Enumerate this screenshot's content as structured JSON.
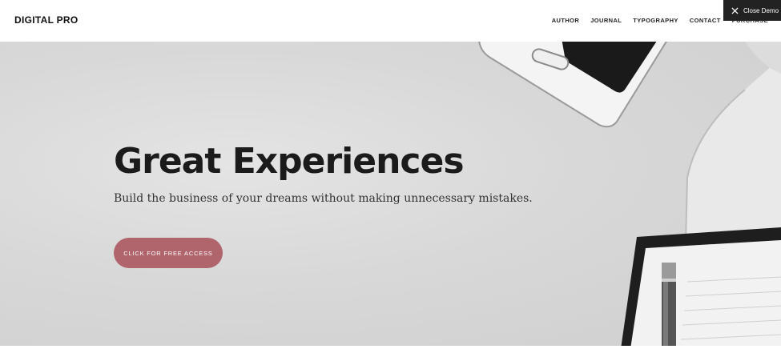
{
  "header": {
    "logo": "DIGITAL PRO",
    "nav": [
      {
        "label": "AUTHOR"
      },
      {
        "label": "JOURNAL"
      },
      {
        "label": "TYPOGRAPHY"
      },
      {
        "label": "CONTACT"
      },
      {
        "label": "PURCHASE"
      }
    ]
  },
  "close_demo": {
    "label": "Close Demo",
    "icon": "close-icon"
  },
  "hero": {
    "title": "Great Experiences",
    "subtitle": "Build the business of your dreams without making unnecessary mistakes.",
    "cta_label": "CLICK FOR FREE ACCESS",
    "cta_color": "#b0646b",
    "background_image": "desk-photo"
  }
}
